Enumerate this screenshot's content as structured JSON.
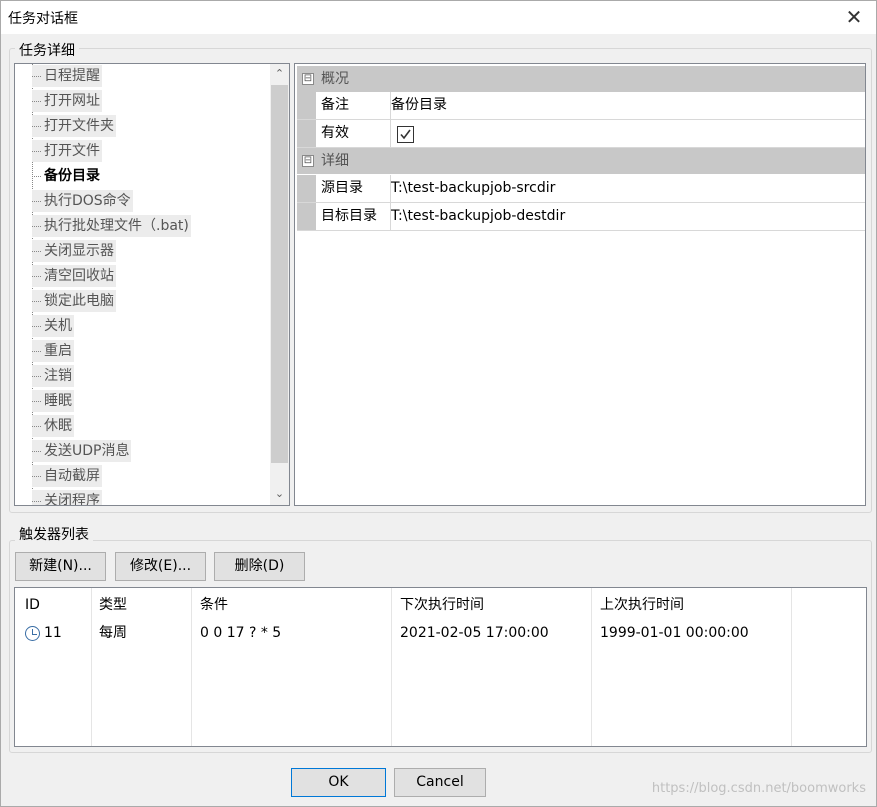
{
  "window": {
    "title": "任务对话框",
    "close_glyph": "✕"
  },
  "task_details": {
    "group_label": "任务详细",
    "task_types": [
      "日程提醒",
      "打开网址",
      "打开文件夹",
      "打开文件",
      "备份目录",
      "执行DOS命令",
      "执行批处理文件（.bat)",
      "关闭显示器",
      "清空回收站",
      "锁定此电脑",
      "关机",
      "重启",
      "注销",
      "睡眠",
      "休眠",
      "发送UDP消息",
      "自动截屏",
      "关闭程序"
    ],
    "selected_type": "备份目录",
    "scroll_up_glyph": "⌃",
    "scroll_down_glyph": "⌄"
  },
  "properties": {
    "category1": {
      "toggle": "⊟",
      "label": "概况"
    },
    "note": {
      "name": "备注",
      "value": "备份目录"
    },
    "enabled": {
      "name": "有效",
      "checked": true,
      "check_glyph": "✓"
    },
    "category2": {
      "toggle": "⊟",
      "label": "详细"
    },
    "source_dir": {
      "name": "源目录",
      "value": "T:\\test-backupjob-srcdir"
    },
    "target_dir": {
      "name": "目标目录",
      "value": "T:\\test-backupjob-destdir"
    }
  },
  "triggers": {
    "group_label": "触发器列表",
    "new_label": "新建(N)...",
    "edit_label": "修改(E)...",
    "delete_label": "删除(D)",
    "columns": [
      "ID",
      "类型",
      "条件",
      "下次执行时间",
      "上次执行时间"
    ],
    "rows": [
      {
        "icon": "clock-icon",
        "id": "11",
        "type": "每周",
        "condition": "0 0 17 ? * 5",
        "next_run": "2021-02-05 17:00:00",
        "last_run": "1999-01-01 00:00:00"
      }
    ]
  },
  "footer": {
    "ok_label": "OK",
    "cancel_label": "Cancel",
    "watermark": "https://blog.csdn.net/boomworks"
  }
}
